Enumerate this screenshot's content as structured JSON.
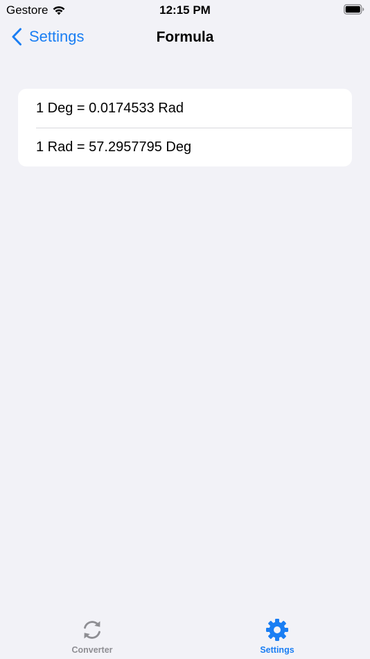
{
  "status_bar": {
    "carrier": "Gestore",
    "time": "12:15 PM",
    "wifi_icon": "wifi-icon",
    "battery_icon": "battery-icon"
  },
  "nav": {
    "back_label": "Settings",
    "back_icon": "chevron-left-icon",
    "title": "Formula"
  },
  "formulas": [
    {
      "text": "1 Deg = 0.0174533 Rad"
    },
    {
      "text": "1 Rad = 57.2957795 Deg"
    }
  ],
  "tab_bar": {
    "tabs": [
      {
        "label": "Converter",
        "icon": "refresh-arrows-icon",
        "selected": false
      },
      {
        "label": "Settings",
        "icon": "gear-icon",
        "selected": true
      }
    ]
  },
  "colors": {
    "accent": "#1a7ef3",
    "background": "#f2f2f7",
    "inactive": "#8e8e93"
  }
}
